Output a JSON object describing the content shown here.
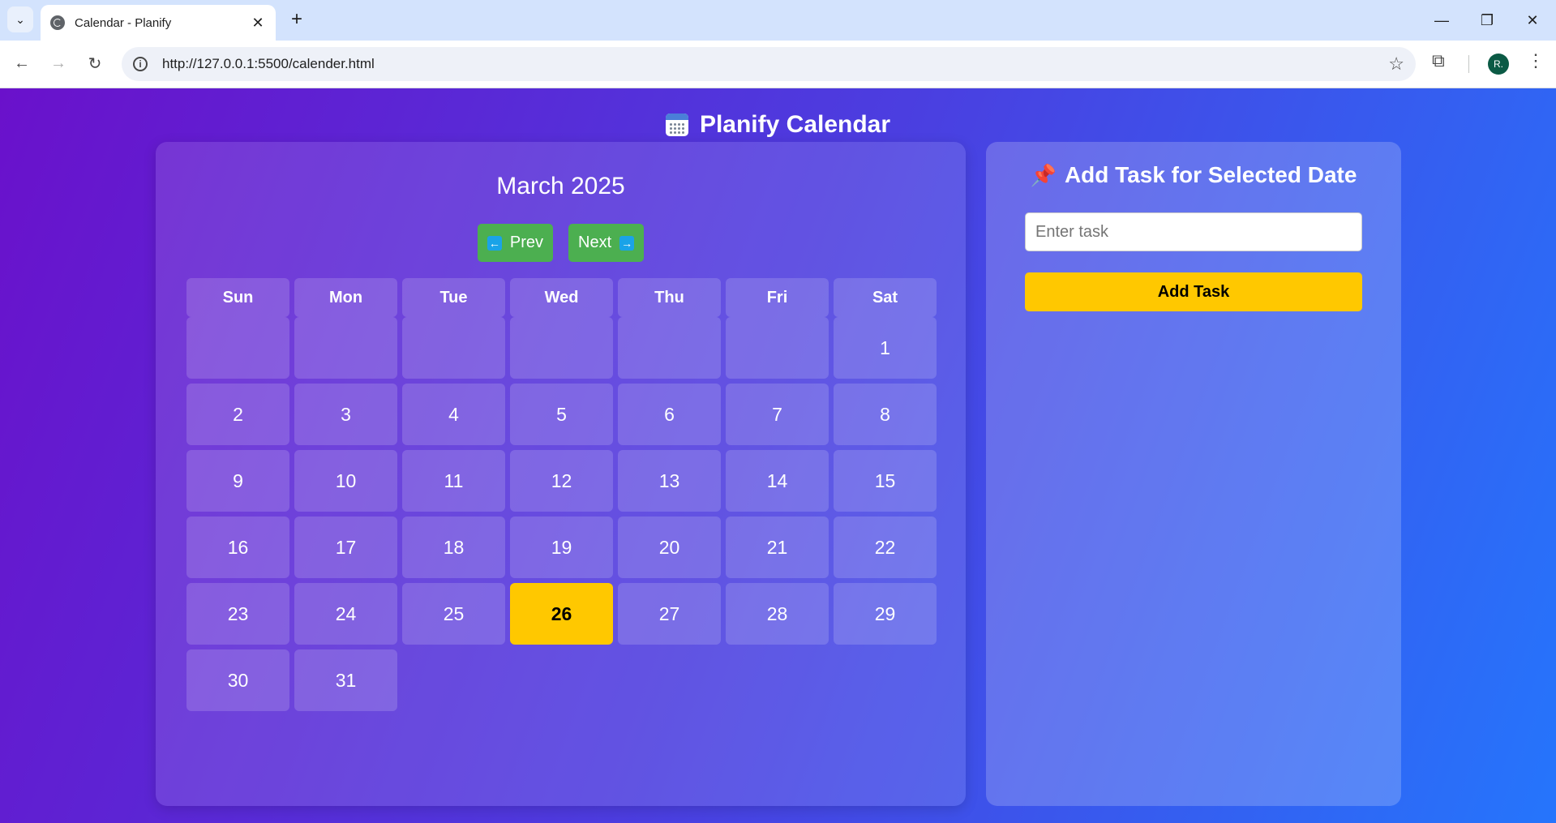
{
  "browser": {
    "tab_title": "Calendar - Planify",
    "url": "http://127.0.0.1:5500/calender.html",
    "profile_initial": "R."
  },
  "page": {
    "title": "Planify Calendar"
  },
  "calendar": {
    "month_label": "March 2025",
    "prev_label": "Prev",
    "next_label": "Next",
    "weekdays": [
      "Sun",
      "Mon",
      "Tue",
      "Wed",
      "Thu",
      "Fri",
      "Sat"
    ],
    "leading_blanks": 6,
    "days": [
      "1",
      "2",
      "3",
      "4",
      "5",
      "6",
      "7",
      "8",
      "9",
      "10",
      "11",
      "12",
      "13",
      "14",
      "15",
      "16",
      "17",
      "18",
      "19",
      "20",
      "21",
      "22",
      "23",
      "24",
      "25",
      "26",
      "27",
      "28",
      "29",
      "30",
      "31"
    ],
    "selected_day": "26",
    "selected_color": "#ffc800"
  },
  "task_panel": {
    "title": "Add Task for Selected Date",
    "input_placeholder": "Enter task",
    "input_value": "",
    "add_button_label": "Add Task"
  }
}
